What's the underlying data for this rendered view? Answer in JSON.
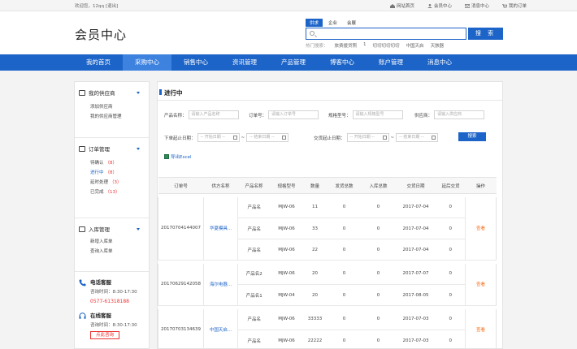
{
  "topbar": {
    "welcome": "欢迎您，12qq",
    "logout": "[退出]",
    "links": [
      {
        "icon": "home-icon",
        "label": "网站首页"
      },
      {
        "icon": "user-icon",
        "label": "会员中心"
      },
      {
        "icon": "mail-icon",
        "label": "消息中心"
      },
      {
        "icon": "cart-icon",
        "label": "我的订单"
      }
    ]
  },
  "header": {
    "title": "会员中心",
    "search_tabs": [
      "供求",
      "企业",
      "会展"
    ],
    "search_placeholder": "",
    "search_button": "搜 索",
    "hot_label": "热门搜索：",
    "hot_words": [
      "旅费援贷照",
      "1",
      "切切切切切切",
      "中国天启",
      "天骸器"
    ]
  },
  "nav": {
    "items": [
      "我的首页",
      "采购中心",
      "销售中心",
      "资讯管理",
      "产品管理",
      "博客中心",
      "账户管理",
      "消息中心"
    ],
    "active_index": 1
  },
  "sidebar": {
    "groups": [
      {
        "icon": "supplier-icon",
        "title": "我的供应商",
        "items": [
          {
            "label": "添加供应商"
          },
          {
            "label": "我的供应商管理"
          }
        ]
      },
      {
        "icon": "order-icon",
        "title": "订单管理",
        "items": [
          {
            "label": "待确认",
            "count": "（8）"
          },
          {
            "label": "进行中",
            "count": "（8）"
          },
          {
            "label": "延时处理",
            "count": "（3）"
          },
          {
            "label": "已完成",
            "count": "（13）"
          }
        ]
      },
      {
        "icon": "warehouse-icon",
        "title": "入库管理",
        "items": [
          {
            "label": "新增入库单"
          },
          {
            "label": "查询入库单"
          }
        ]
      }
    ],
    "phone_service": {
      "title": "电话客服",
      "hours": "咨询时间：8:30-17:30",
      "phone": "0577-61318188"
    },
    "online_service": {
      "title": "在线客服",
      "hours": "咨询时间：8:30-17:30",
      "button": "点此咨询"
    }
  },
  "main": {
    "title": "进行中",
    "filters": {
      "product_name_label": "产品名称：",
      "product_name_placeholder": "请输入产品名称",
      "order_no_label": "订单号：",
      "order_no_placeholder": "请输入订单号",
      "spec_label": "规格型号：",
      "spec_placeholder": "请输入规格型号",
      "supplier_label": "供应商：",
      "supplier_placeholder": "请输入供应商",
      "order_date_label": "下单起止日期：",
      "delivery_date_label": "交货起止日期：",
      "start_placeholder": "-- 开始日期 --",
      "end_placeholder": "-- 结束日期 --",
      "search_button": "搜索"
    },
    "export_label": "导出Excel",
    "columns": [
      "订单号",
      "供方名称",
      "产品名称",
      "规格型号",
      "数量",
      "发货总数",
      "入库总数",
      "交货日期",
      "延后交货",
      "操作"
    ],
    "orders": [
      {
        "order_no": "20170704144007",
        "supplier": "华夏模具...",
        "action": "查看",
        "lines": [
          {
            "product": "产品名",
            "spec": "MJW-06",
            "qty": "11",
            "shipped": "0",
            "stocked": "0",
            "date": "2017-07-04",
            "delay": "0"
          },
          {
            "product": "产品名",
            "spec": "MJW-06",
            "qty": "33",
            "shipped": "0",
            "stocked": "0",
            "date": "2017-07-04",
            "delay": "0"
          },
          {
            "product": "产品名",
            "spec": "MJW-06",
            "qty": "22",
            "shipped": "0",
            "stocked": "0",
            "date": "2017-07-04",
            "delay": "0"
          }
        ]
      },
      {
        "order_no": "20170629142058",
        "supplier": "海尔电器...",
        "action": "查看",
        "lines": [
          {
            "product": "产品名2",
            "spec": "MJW-06",
            "qty": "20",
            "shipped": "0",
            "stocked": "0",
            "date": "2017-07-07",
            "delay": "0"
          },
          {
            "product": "产品名1",
            "spec": "MJW-04",
            "qty": "20",
            "shipped": "0",
            "stocked": "0",
            "date": "2017-08-05",
            "delay": "0"
          }
        ]
      },
      {
        "order_no": "20170703134639",
        "supplier": "中国天启...",
        "action": "查看",
        "lines": [
          {
            "product": "产品名",
            "spec": "MJW-06",
            "qty": "33333",
            "shipped": "0",
            "stocked": "0",
            "date": "2017-07-03",
            "delay": "0"
          },
          {
            "product": "产品名",
            "spec": "MJW-06",
            "qty": "22222",
            "shipped": "0",
            "stocked": "0",
            "date": "2017-07-03",
            "delay": "0"
          }
        ]
      }
    ]
  },
  "colors": {
    "brand_blue": "#1d64c8",
    "nav_active": "#3e82e0",
    "count_red": "#e33",
    "action_orange": "#f36f1b"
  }
}
